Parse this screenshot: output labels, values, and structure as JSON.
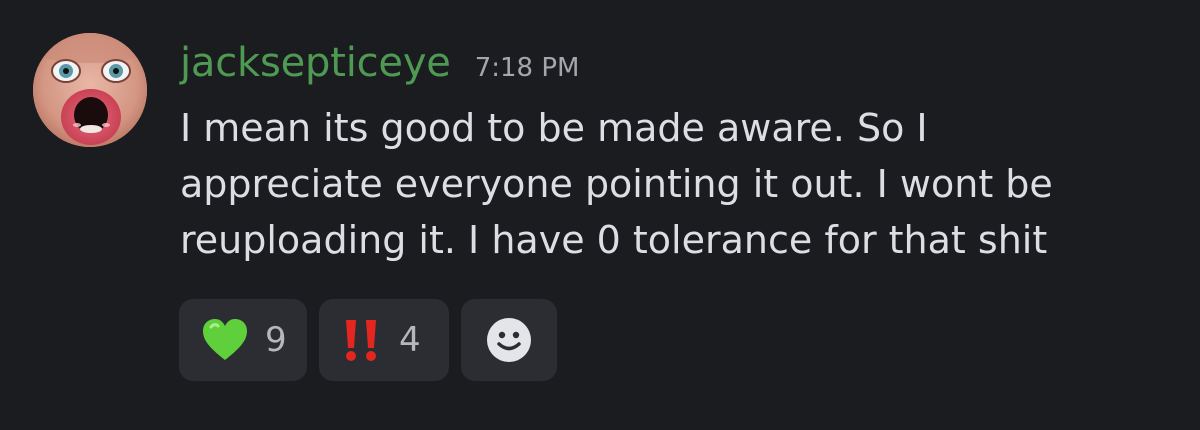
{
  "message": {
    "author": "jacksepticeye",
    "timestamp": "7:18 PM",
    "lines": [
      "I mean its good to be made aware. So I",
      "appreciate everyone pointing it out. I wont be",
      "reuploading it. I have 0 tolerance for that shit"
    ]
  },
  "reactions": [
    {
      "emoji": "green-heart",
      "count": "9"
    },
    {
      "emoji": "double-exclamation",
      "count": "4"
    }
  ],
  "add_reaction": {
    "icon": "smiley-add-reaction-icon"
  },
  "colors": {
    "background": "#1b1c20",
    "username": "#4e9a52",
    "text": "#dcdee3",
    "timestamp": "#a4a6ad",
    "reaction_bg": "#2b2d33",
    "heart": "#5fcf3c",
    "exclamation": "#e3261f"
  }
}
